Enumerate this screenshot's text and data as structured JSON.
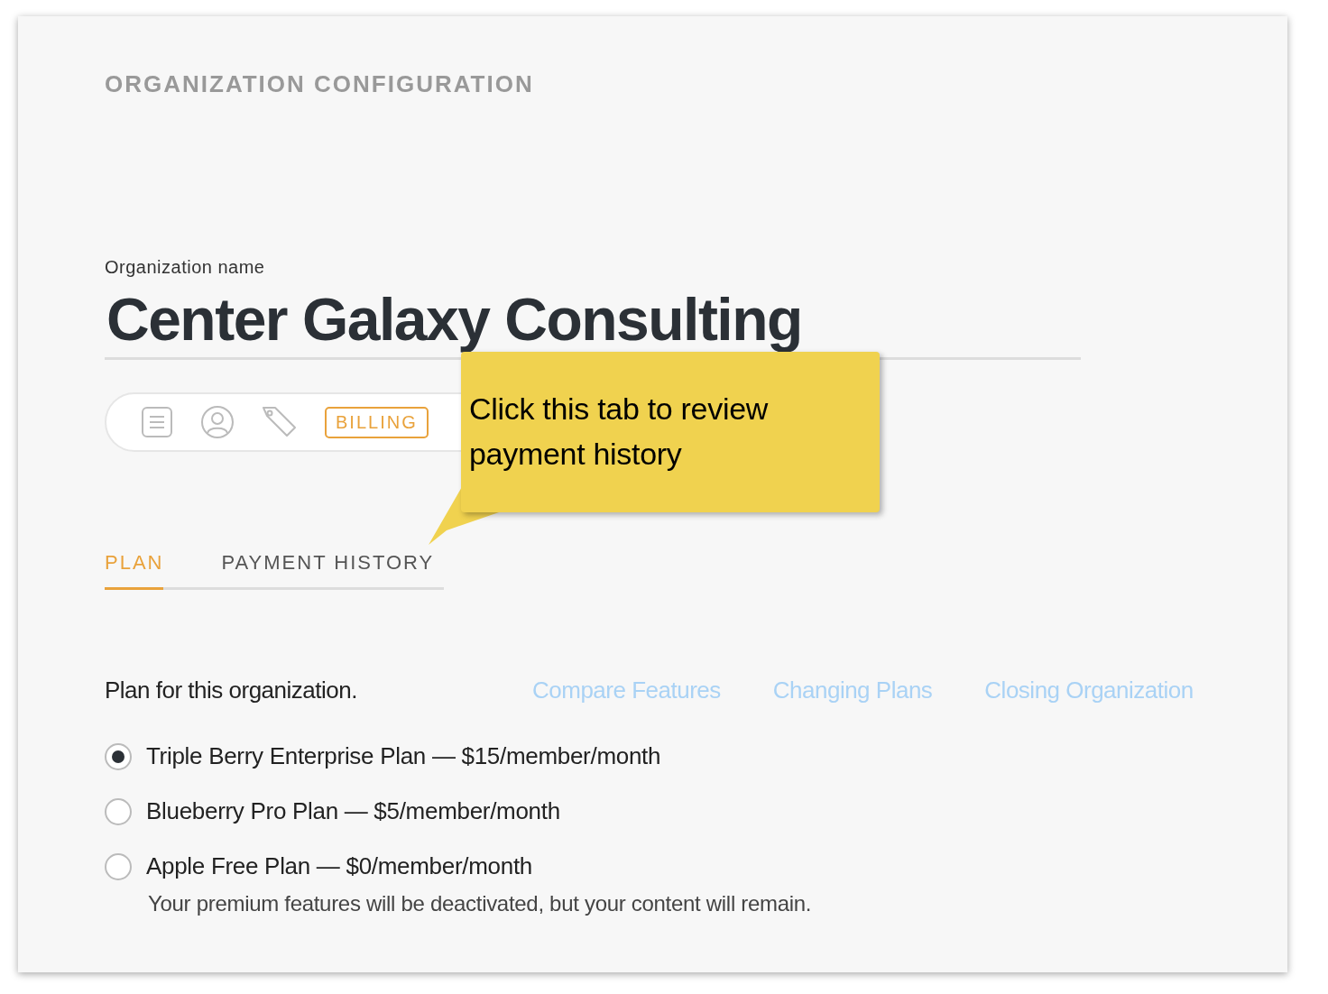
{
  "page_title": "ORGANIZATION CONFIGURATION",
  "name_field": {
    "label": "Organization name",
    "value": "Center Galaxy Consulting"
  },
  "icon_tabs": [
    {
      "kind": "icon",
      "selected": false
    },
    {
      "kind": "icon",
      "selected": false
    },
    {
      "kind": "icon",
      "selected": false
    },
    {
      "kind": "label",
      "label": "BILLING",
      "selected": true
    }
  ],
  "tabs": [
    {
      "label": "PLAN",
      "selected": true
    },
    {
      "label": "PAYMENT HISTORY",
      "selected": false
    }
  ],
  "plan_section": {
    "heading": "Plan for this organization.",
    "links": [
      "Compare Features",
      "Changing Plans",
      "Closing Organization"
    ],
    "options": [
      {
        "label": "Triple Berry Enterprise Plan — $15/member/month",
        "selected": true
      },
      {
        "label": "Blueberry Pro Plan — $5/member/month",
        "selected": false
      },
      {
        "label": "Apple Free Plan — $0/member/month",
        "selected": false,
        "note": "Your premium features will be deactivated, but your content will remain."
      }
    ]
  },
  "callout": {
    "text": "Click this tab to review payment history"
  }
}
